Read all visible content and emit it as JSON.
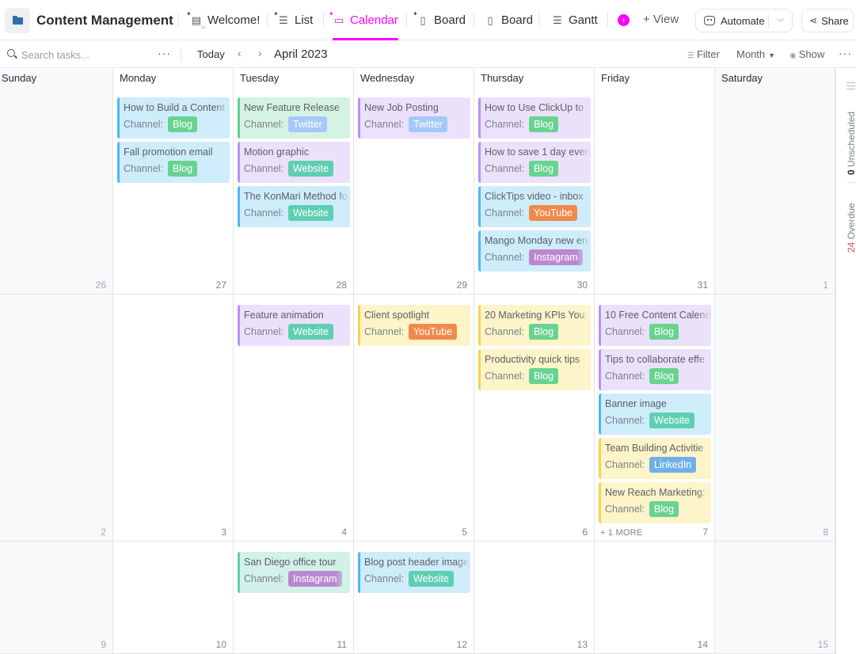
{
  "header": {
    "space_icon": "folder-icon",
    "title": "Content Management",
    "tabs": [
      {
        "label": "Welcome!",
        "icon": "doc-icon",
        "pinned": true,
        "active": false
      },
      {
        "label": "List",
        "icon": "list-icon",
        "pinned": true,
        "active": false
      },
      {
        "label": "Calendar",
        "icon": "calendar-icon",
        "pinned": true,
        "active": true
      },
      {
        "label": "Board",
        "icon": "board-icon",
        "pinned": true,
        "active": false
      },
      {
        "label": "Board",
        "icon": "board-icon",
        "pinned": false,
        "active": false
      },
      {
        "label": "Gantt",
        "icon": "gantt-icon",
        "pinned": false,
        "active": false
      }
    ],
    "more_views_icon": "chevron-right-circle-icon",
    "add_view_label": "+ View",
    "automate_label": "Automate",
    "share_label": "Share",
    "accent_color": "#ff00ff"
  },
  "toolbar": {
    "search_placeholder": "Search tasks...",
    "more_label": "···",
    "today_label": "Today",
    "prev_label": "‹",
    "next_label": "›",
    "month_label": "April 2023",
    "filter_label": "Filter",
    "view_mode_label": "Month",
    "show_label": "Show",
    "overflow_label": "···"
  },
  "weekdays": [
    "Sunday",
    "Monday",
    "Tuesday",
    "Wednesday",
    "Thursday",
    "Friday",
    "Saturday"
  ],
  "calendar": {
    "channel_label": "Channel:",
    "weeks": [
      {
        "days": [
          {
            "num": "26",
            "tasks": []
          },
          {
            "num": "27",
            "tasks": [
              {
                "title": "How to Build a Content",
                "channel": "Blog",
                "color": "blue"
              },
              {
                "title": "Fall promotion email",
                "channel": "Blog",
                "color": "blue"
              }
            ]
          },
          {
            "num": "28",
            "tasks": [
              {
                "title": "New Feature Release",
                "channel": "Twitter",
                "color": "green"
              },
              {
                "title": "Motion graphic",
                "channel": "Website",
                "color": "purple"
              },
              {
                "title": "The KonMari Method fo",
                "channel": "Website",
                "color": "blue"
              }
            ]
          },
          {
            "num": "29",
            "tasks": [
              {
                "title": "New Job Posting",
                "channel": "Twitter",
                "color": "purple"
              }
            ]
          },
          {
            "num": "30",
            "tasks": [
              {
                "title": "How to Use ClickUp to",
                "channel": "Blog",
                "color": "purple"
              },
              {
                "title": "How to save 1 day ever",
                "channel": "Blog",
                "color": "purple"
              },
              {
                "title": "ClickTips video - inbox",
                "channel": "YouTube",
                "color": "blue"
              },
              {
                "title": "Mango Monday new en",
                "channel": "Instagram",
                "color": "blue"
              }
            ]
          },
          {
            "num": "31",
            "tasks": []
          },
          {
            "num": "1",
            "tasks": []
          }
        ]
      },
      {
        "days": [
          {
            "num": "2",
            "tasks": []
          },
          {
            "num": "3",
            "tasks": []
          },
          {
            "num": "4",
            "tasks": [
              {
                "title": "Feature animation",
                "channel": "Website",
                "color": "purple"
              }
            ]
          },
          {
            "num": "5",
            "tasks": [
              {
                "title": "Client spotlight",
                "channel": "YouTube",
                "color": "yellow"
              }
            ]
          },
          {
            "num": "6",
            "tasks": [
              {
                "title": "20 Marketing KPIs You",
                "channel": "Blog",
                "color": "yellow"
              },
              {
                "title": "Productivity quick tips",
                "channel": "Blog",
                "color": "yellow"
              }
            ]
          },
          {
            "num": "7",
            "more": "+ 1 MORE",
            "tasks": [
              {
                "title": "10 Free Content Calend",
                "channel": "Blog",
                "color": "purple"
              },
              {
                "title": "Tips to collaborate effe",
                "channel": "Blog",
                "color": "purple"
              },
              {
                "title": "Banner image",
                "channel": "Website",
                "color": "blue"
              },
              {
                "title": "Team Building Activitie",
                "channel": "LinkedIn",
                "color": "yellow"
              },
              {
                "title": "New Reach Marketing:",
                "channel": "Blog",
                "color": "yellow"
              }
            ]
          },
          {
            "num": "8",
            "tasks": []
          }
        ]
      },
      {
        "days": [
          {
            "num": "9",
            "tasks": []
          },
          {
            "num": "10",
            "tasks": []
          },
          {
            "num": "11",
            "tasks": [
              {
                "title": "San Diego office tour",
                "channel": "Instagram",
                "color": "teal"
              }
            ]
          },
          {
            "num": "12",
            "tasks": [
              {
                "title": "Blog post header image",
                "channel": "Website",
                "color": "blue"
              }
            ]
          },
          {
            "num": "13",
            "tasks": []
          },
          {
            "num": "14",
            "tasks": []
          },
          {
            "num": "15",
            "tasks": []
          }
        ]
      }
    ],
    "channel_colors": {
      "Blog": "#68d391",
      "Twitter": "#a5c8fb",
      "Website": "#5ecfb2",
      "YouTube": "#f08a4b",
      "Instagram": "#bb88cf",
      "LinkedIn": "#6fb0e8"
    }
  },
  "sidebar": {
    "unscheduled_count": "0",
    "unscheduled_label": "Unscheduled",
    "overdue_count": "24",
    "overdue_label": "Overdue"
  }
}
